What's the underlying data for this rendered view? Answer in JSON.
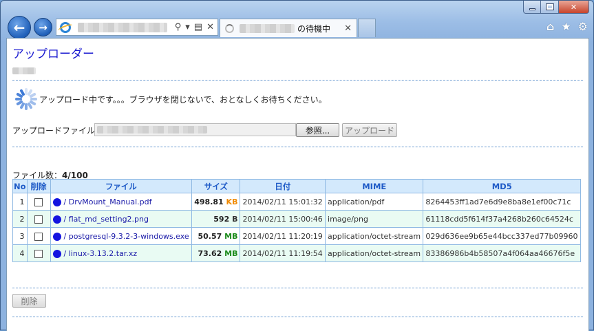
{
  "browser": {
    "tab_title": "の待機中",
    "icons": [
      "back-icon",
      "forward-icon",
      "ie-icon",
      "search-icon",
      "dropdown-icon",
      "compat-icon",
      "close-icon",
      "home-icon",
      "favorites-icon",
      "gear-icon"
    ]
  },
  "page": {
    "title": "アップローダー",
    "uploading_message": "アップロード中です。。。ブラウザを閉じないで、おとなしくお待ちください。",
    "upload_label": "アップロードファイル：",
    "browse_label": "参照...",
    "upload_label_btn": "アップロード",
    "file_count_label": "ファイル数：",
    "file_count_value": "4/100",
    "delete_label": "削除"
  },
  "table": {
    "headers": [
      "No",
      "削除",
      "ファイル",
      "サイズ",
      "日付",
      "MIME",
      "MD5"
    ],
    "rows": [
      {
        "no": "1",
        "name": "/ DrvMount_Manual.pdf",
        "size": "498.81",
        "unit": "KB",
        "date": "2014/02/11 15:01:32",
        "mime": "application/pdf",
        "md5": "8264453ff1ad7e6d9e8ba8e1ef00c71c"
      },
      {
        "no": "2",
        "name": "/ flat_md_setting2.png",
        "size": "592",
        "unit": "B",
        "date": "2014/02/11 15:00:46",
        "mime": "image/png",
        "md5": "61118cdd5f614f37a4268b260c64524c"
      },
      {
        "no": "3",
        "name": "/ postgresql-9.3.2-3-windows.exe",
        "size": "50.57",
        "unit": "MB",
        "date": "2014/02/11 11:20:19",
        "mime": "application/octet-stream",
        "md5": "029d636ee9b65e44bcc337ed77b09960"
      },
      {
        "no": "4",
        "name": "/ linux-3.13.2.tar.xz",
        "size": "73.62",
        "unit": "MB",
        "date": "2014/02/11 11:19:54",
        "mime": "application/octet-stream",
        "md5": "83386986b4b58507a4f064aa46676f5e"
      }
    ]
  },
  "colors": {
    "title": "#1a1ad0",
    "header_bg": "#d3e9fc",
    "row_alt": "#e9fbf3",
    "kb": "#f08a00",
    "mb": "#1a8a1a"
  }
}
